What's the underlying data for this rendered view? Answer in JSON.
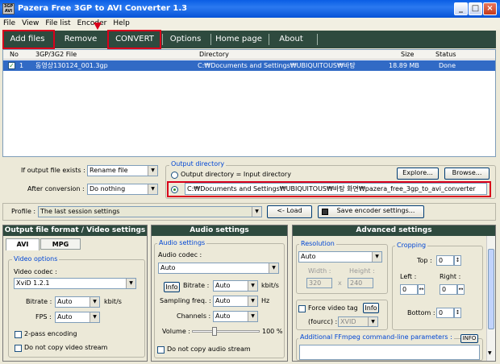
{
  "window": {
    "title": "Pazera Free 3GP to AVI Converter 1.3",
    "icon_text": "3GP AVI"
  },
  "menu": [
    "File",
    "View",
    "File list",
    "Encoder",
    "Help"
  ],
  "toolbar": {
    "add_files": "Add files",
    "remove": "Remove",
    "convert": "CONVERT",
    "options": "Options",
    "home_page": "Home page",
    "about": "About"
  },
  "file_list": {
    "columns": {
      "no": "No",
      "file": "3GP/3G2 File",
      "directory": "Directory",
      "size": "Size",
      "status": "Status"
    },
    "rows": [
      {
        "no": "1",
        "file": "동영상130124_001.3gp",
        "directory": "C:₩Documents and Settings₩UBIQUITOUS₩바탕",
        "size": "18.89 MB",
        "status": "Done"
      }
    ]
  },
  "output": {
    "if_exists_label": "If output file exists :",
    "if_exists_value": "Rename file",
    "after_conv_label": "After conversion :",
    "after_conv_value": "Do nothing",
    "dir_group_title": "Output directory",
    "radio_same": "Output directory = Input directory",
    "dir_value": "C:₩Documents and Settings₩UBIQUITOUS₩바탕 화면₩pazera_free_3gp_to_avi_converter",
    "explore": "Explore...",
    "browse": "Browse..."
  },
  "profile": {
    "label": "Profile :",
    "value": "The last session settings",
    "load": "<- Load",
    "save": "Save encoder settings..."
  },
  "video_panel": {
    "title": "Output file format / Video settings",
    "tab_avi": "AVI",
    "tab_mpg": "MPG",
    "group": "Video options",
    "codec_label": "Video codec :",
    "codec_value": "XviD 1.2.1",
    "bitrate_label": "Bitrate :",
    "bitrate_value": "Auto",
    "bitrate_unit": "kbit/s",
    "fps_label": "FPS :",
    "fps_value": "Auto",
    "two_pass": "2-pass encoding",
    "no_copy": "Do not copy video stream"
  },
  "audio_panel": {
    "title": "Audio settings",
    "group": "Audio settings",
    "codec_label": "Audio codec :",
    "codec_value": "Auto",
    "info": "Info",
    "bitrate_label": "Bitrate :",
    "bitrate_value": "Auto",
    "bitrate_unit": "kbit/s",
    "freq_label": "Sampling freq. :",
    "freq_value": "Auto",
    "freq_unit": "Hz",
    "channels_label": "Channels :",
    "channels_value": "Auto",
    "volume_label": "Volume :",
    "volume_value": "100 %",
    "volume_level": 0.33,
    "no_copy": "Do not copy audio stream"
  },
  "advanced_panel": {
    "title": "Advanced settings",
    "resolution": "Resolution",
    "res_value": "Auto",
    "width_label": "Width :",
    "width_value": "320",
    "height_label": "Height :",
    "height_value": "240",
    "x": "x",
    "force_tag": "Force video tag",
    "info": "Info",
    "fourcc_label": "(fourcc) :",
    "fourcc_value": "XVID",
    "cropping": "Cropping",
    "top_label": "Top :",
    "top_value": "0",
    "left_label": "Left :",
    "left_value": "0",
    "right_label": "Right :",
    "right_value": "0",
    "bottom_label": "Bottom :",
    "bottom_value": "0",
    "ffmpeg_label": "Additional FFmpeg command-line parameters :",
    "ffmpeg_info": "INFO"
  },
  "colors": {
    "accent": "#2e4a3e",
    "highlight": "#d9001b",
    "selection": "#316ac5"
  }
}
